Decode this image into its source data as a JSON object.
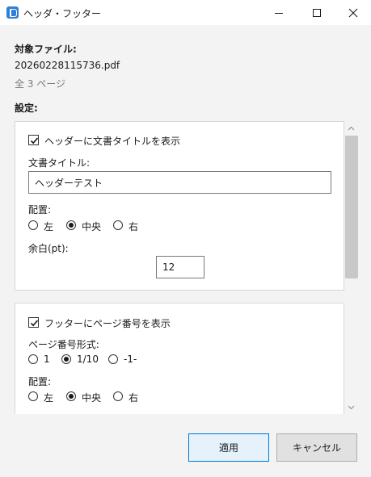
{
  "window": {
    "title": "ヘッダ・フッター",
    "minimize_icon": "minimize-icon",
    "maximize_icon": "maximize-icon",
    "close_icon": "close-icon"
  },
  "target": {
    "heading": "対象ファイル:",
    "filename": "20260228115736.pdf",
    "pages": "全 3 ページ"
  },
  "settings": {
    "heading": "設定:",
    "header": {
      "checkbox_label": "ヘッダーに文書タイトルを表示",
      "checked": true,
      "title_label": "文書タイトル:",
      "title_value": "ヘッダーテスト",
      "align_label": "配置:",
      "align_options": [
        "左",
        "中央",
        "右"
      ],
      "align_selected": "中央",
      "margin_label": "余白(pt):",
      "margin_value": "12"
    },
    "footer": {
      "checkbox_label": "フッターにページ番号を表示",
      "checked": true,
      "format_label": "ページ番号形式:",
      "format_options": [
        "1",
        "1/10",
        "-1-"
      ],
      "format_selected": "1/10",
      "align_label": "配置:",
      "align_options": [
        "左",
        "中央",
        "右"
      ],
      "align_selected": "中央"
    }
  },
  "buttons": {
    "apply": "適用",
    "cancel": "キャンセル"
  }
}
